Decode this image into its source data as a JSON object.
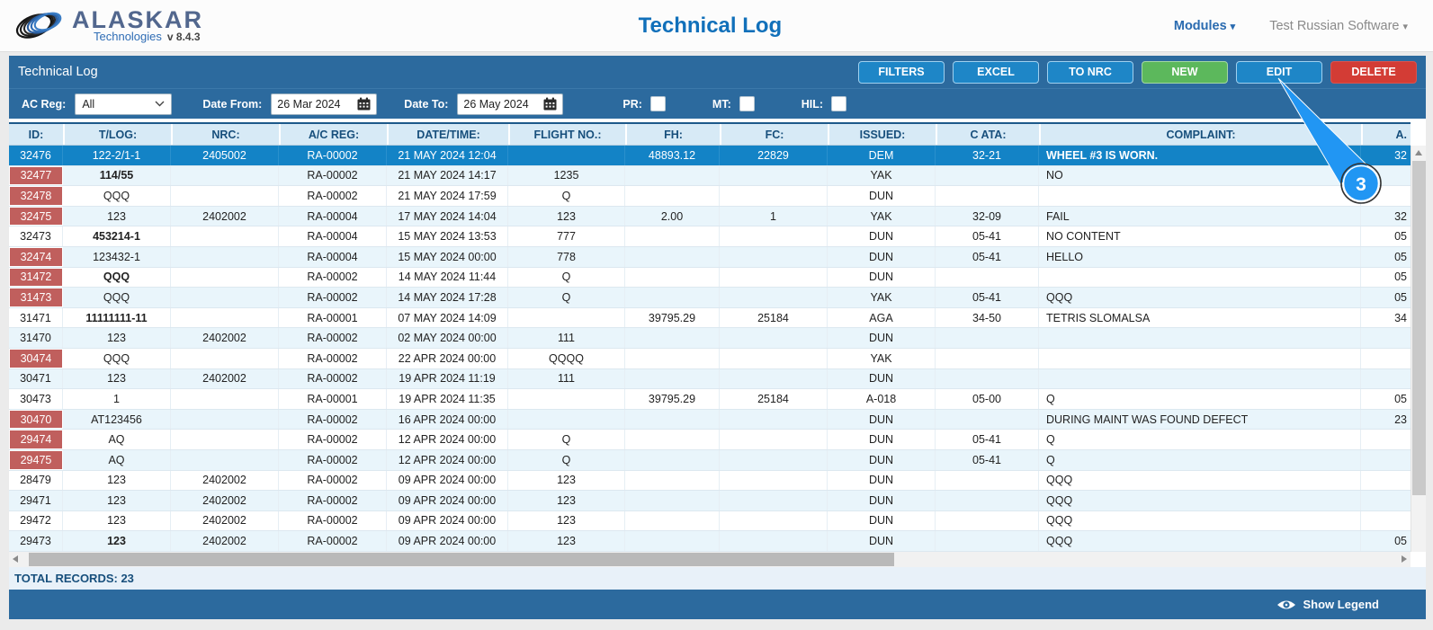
{
  "header": {
    "logo": {
      "brand": "ALASKAR",
      "sub": "Technologies",
      "version": "v 8.4.3"
    },
    "title": "Technical Log",
    "nav": [
      {
        "label": "Modules"
      },
      {
        "label": "Test Russian Software"
      }
    ]
  },
  "panel": {
    "title": "Technical Log",
    "buttons": [
      {
        "label": "FILTERS",
        "style": "blue"
      },
      {
        "label": "EXCEL",
        "style": "blue"
      },
      {
        "label": "TO NRC",
        "style": "blue"
      },
      {
        "label": "NEW",
        "style": "green"
      },
      {
        "label": "EDIT",
        "style": "blue"
      },
      {
        "label": "DELETE",
        "style": "red"
      }
    ]
  },
  "filters": {
    "ac_reg_label": "AC Reg:",
    "ac_reg_value": "All",
    "date_from_label": "Date From:",
    "date_from_value": "26 Mar 2024",
    "date_to_label": "Date To:",
    "date_to_value": "26 May 2024",
    "checkboxes": [
      {
        "label": "PR:",
        "checked": false
      },
      {
        "label": "MT:",
        "checked": false
      },
      {
        "label": "HIL:",
        "checked": false
      }
    ]
  },
  "table": {
    "columns": [
      "ID:",
      "T/LOG:",
      "NRC:",
      "A/C REG:",
      "DATE/TIME:",
      "FLIGHT NO.:",
      "FH:",
      "FC:",
      "ISSUED:",
      "C ATA:",
      "COMPLAINT:",
      "A."
    ],
    "rows": [
      {
        "id": "32476",
        "state": "selected",
        "tlog": "122-2/1-1",
        "tlog_bold": false,
        "nrc": "2405002",
        "acreg": "RA-00002",
        "datetime": "21 MAY 2024 12:04",
        "flight": "",
        "fh": "48893.12",
        "fc": "22829",
        "issued": "DEM",
        "cata": "32-21",
        "complaint": "WHEEL #3 IS WORN.",
        "a": "32"
      },
      {
        "id": "32477",
        "state": "flagged",
        "tlog": "114/55",
        "tlog_bold": true,
        "nrc": "",
        "acreg": "RA-00002",
        "datetime": "21 MAY 2024 14:17",
        "flight": "1235",
        "fh": "",
        "fc": "",
        "issued": "YAK",
        "cata": "",
        "complaint": "NO",
        "a": ""
      },
      {
        "id": "32478",
        "state": "flagged",
        "tlog": "QQQ",
        "tlog_bold": false,
        "nrc": "",
        "acreg": "RA-00002",
        "datetime": "21 MAY 2024 17:59",
        "flight": "Q",
        "fh": "",
        "fc": "",
        "issued": "DUN",
        "cata": "",
        "complaint": "",
        "a": ""
      },
      {
        "id": "32475",
        "state": "flagged",
        "tlog": "123",
        "tlog_bold": false,
        "nrc": "2402002",
        "acreg": "RA-00004",
        "datetime": "17 MAY 2024 14:04",
        "flight": "123",
        "fh": "2.00",
        "fc": "1",
        "issued": "YAK",
        "cata": "32-09",
        "complaint": "FAIL",
        "a": "32"
      },
      {
        "id": "32473",
        "state": "normal",
        "tlog": "453214-1",
        "tlog_bold": true,
        "nrc": "",
        "acreg": "RA-00004",
        "datetime": "15 MAY 2024 13:53",
        "flight": "777",
        "fh": "",
        "fc": "",
        "issued": "DUN",
        "cata": "05-41",
        "complaint": "NO CONTENT",
        "a": "05"
      },
      {
        "id": "32474",
        "state": "flagged",
        "tlog": "123432-1",
        "tlog_bold": false,
        "nrc": "",
        "acreg": "RA-00004",
        "datetime": "15 MAY 2024 00:00",
        "flight": "778",
        "fh": "",
        "fc": "",
        "issued": "DUN",
        "cata": "05-41",
        "complaint": "HELLO",
        "a": "05"
      },
      {
        "id": "31472",
        "state": "flagged",
        "tlog": "QQQ",
        "tlog_bold": true,
        "nrc": "",
        "acreg": "RA-00002",
        "datetime": "14 MAY 2024 11:44",
        "flight": "Q",
        "fh": "",
        "fc": "",
        "issued": "DUN",
        "cata": "",
        "complaint": "",
        "a": "05"
      },
      {
        "id": "31473",
        "state": "flagged",
        "tlog": "QQQ",
        "tlog_bold": false,
        "nrc": "",
        "acreg": "RA-00002",
        "datetime": "14 MAY 2024 17:28",
        "flight": "Q",
        "fh": "",
        "fc": "",
        "issued": "YAK",
        "cata": "05-41",
        "complaint": "QQQ",
        "a": "05"
      },
      {
        "id": "31471",
        "state": "normal",
        "tlog": "11111111-11",
        "tlog_bold": true,
        "nrc": "",
        "acreg": "RA-00001",
        "datetime": "07 MAY 2024 14:09",
        "flight": "",
        "fh": "39795.29",
        "fc": "25184",
        "issued": "AGA",
        "cata": "34-50",
        "complaint": "TETRIS SLOMALSA",
        "a": "34"
      },
      {
        "id": "31470",
        "state": "normal",
        "tlog": "123",
        "tlog_bold": false,
        "nrc": "2402002",
        "acreg": "RA-00002",
        "datetime": "02 MAY 2024 00:00",
        "flight": "111",
        "fh": "",
        "fc": "",
        "issued": "DUN",
        "cata": "",
        "complaint": "",
        "a": ""
      },
      {
        "id": "30474",
        "state": "flagged",
        "tlog": "QQQ",
        "tlog_bold": false,
        "nrc": "",
        "acreg": "RA-00002",
        "datetime": "22 APR 2024 00:00",
        "flight": "QQQQ",
        "fh": "",
        "fc": "",
        "issued": "YAK",
        "cata": "",
        "complaint": "",
        "a": ""
      },
      {
        "id": "30471",
        "state": "normal",
        "tlog": "123",
        "tlog_bold": false,
        "nrc": "2402002",
        "acreg": "RA-00002",
        "datetime": "19 APR 2024 11:19",
        "flight": "111",
        "fh": "",
        "fc": "",
        "issued": "DUN",
        "cata": "",
        "complaint": "",
        "a": ""
      },
      {
        "id": "30473",
        "state": "normal",
        "tlog": "1",
        "tlog_bold": false,
        "nrc": "",
        "acreg": "RA-00001",
        "datetime": "19 APR 2024 11:35",
        "flight": "",
        "fh": "39795.29",
        "fc": "25184",
        "issued": "A-018",
        "cata": "05-00",
        "complaint": "Q",
        "a": "05"
      },
      {
        "id": "30470",
        "state": "flagged",
        "tlog": "AT123456",
        "tlog_bold": false,
        "nrc": "",
        "acreg": "RA-00002",
        "datetime": "16 APR 2024 00:00",
        "flight": "",
        "fh": "",
        "fc": "",
        "issued": "DUN",
        "cata": "",
        "complaint": "DURING MAINT WAS FOUND DEFECT",
        "a": "23"
      },
      {
        "id": "29474",
        "state": "flagged",
        "tlog": "AQ",
        "tlog_bold": false,
        "nrc": "",
        "acreg": "RA-00002",
        "datetime": "12 APR 2024 00:00",
        "flight": "Q",
        "fh": "",
        "fc": "",
        "issued": "DUN",
        "cata": "05-41",
        "complaint": "Q",
        "a": ""
      },
      {
        "id": "29475",
        "state": "flagged",
        "tlog": "AQ",
        "tlog_bold": false,
        "nrc": "",
        "acreg": "RA-00002",
        "datetime": "12 APR 2024 00:00",
        "flight": "Q",
        "fh": "",
        "fc": "",
        "issued": "DUN",
        "cata": "05-41",
        "complaint": "Q",
        "a": ""
      },
      {
        "id": "28479",
        "state": "normal",
        "tlog": "123",
        "tlog_bold": false,
        "nrc": "2402002",
        "acreg": "RA-00002",
        "datetime": "09 APR 2024 00:00",
        "flight": "123",
        "fh": "",
        "fc": "",
        "issued": "DUN",
        "cata": "",
        "complaint": "QQQ",
        "a": ""
      },
      {
        "id": "29471",
        "state": "normal",
        "tlog": "123",
        "tlog_bold": false,
        "nrc": "2402002",
        "acreg": "RA-00002",
        "datetime": "09 APR 2024 00:00",
        "flight": "123",
        "fh": "",
        "fc": "",
        "issued": "DUN",
        "cata": "",
        "complaint": "QQQ",
        "a": ""
      },
      {
        "id": "29472",
        "state": "normal",
        "tlog": "123",
        "tlog_bold": false,
        "nrc": "2402002",
        "acreg": "RA-00002",
        "datetime": "09 APR 2024 00:00",
        "flight": "123",
        "fh": "",
        "fc": "",
        "issued": "DUN",
        "cata": "",
        "complaint": "QQQ",
        "a": ""
      },
      {
        "id": "29473",
        "state": "normal",
        "tlog": "123",
        "tlog_bold": true,
        "nrc": "2402002",
        "acreg": "RA-00002",
        "datetime": "09 APR 2024 00:00",
        "flight": "123",
        "fh": "",
        "fc": "",
        "issued": "DUN",
        "cata": "",
        "complaint": "QQQ",
        "a": "05"
      }
    ]
  },
  "status": {
    "total_records": "TOTAL RECORDS: 23"
  },
  "footer": {
    "show_legend": "Show Legend"
  },
  "annotation": {
    "step": "3"
  },
  "colors": {
    "accent_blue": "#2c6a9e",
    "selected_row": "#1383c6",
    "flag_red": "#c05f5d",
    "button_blue": "#1e86c7",
    "button_green": "#5cb85c",
    "button_red": "#d33c35",
    "annotation_blue": "#2196f3",
    "title_blue": "#1170ba"
  }
}
